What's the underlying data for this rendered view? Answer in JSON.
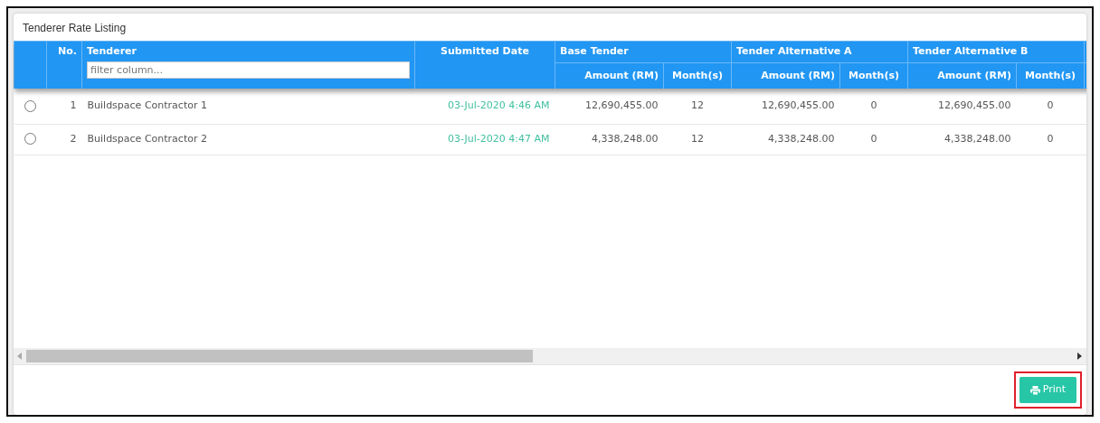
{
  "title": "Tenderer Rate Listing",
  "columns": {
    "number": "No.",
    "tenderer": "Tenderer",
    "filter_placeholder": "filter column...",
    "submitted_date": "Submitted Date",
    "groups": [
      {
        "name": "Base Tender",
        "amount": "Amount (RM)",
        "months": "Month(s)"
      },
      {
        "name": "Tender Alternative A",
        "amount": "Amount (RM)",
        "months": "Month(s)"
      },
      {
        "name": "Tender Alternative B",
        "amount": "Amount (RM)",
        "months": "Month(s)"
      }
    ]
  },
  "rows": [
    {
      "selected": false,
      "number": "1",
      "tenderer": "Buildspace Contractor 1",
      "submitted_date": "03-Jul-2020 4:46 AM",
      "values": [
        {
          "amount": "12,690,455.00",
          "months": "12"
        },
        {
          "amount": "12,690,455.00",
          "months": "0"
        },
        {
          "amount": "12,690,455.00",
          "months": "0"
        }
      ]
    },
    {
      "selected": false,
      "number": "2",
      "tenderer": "Buildspace Contractor 2",
      "submitted_date": "03-Jul-2020 4:47 AM",
      "values": [
        {
          "amount": "4,338,248.00",
          "months": "12"
        },
        {
          "amount": "4,338,248.00",
          "months": "0"
        },
        {
          "amount": "4,338,248.00",
          "months": "0"
        }
      ]
    }
  ],
  "print_button": "Print"
}
